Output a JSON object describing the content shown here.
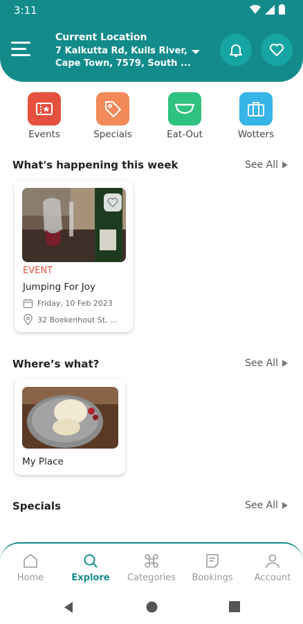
{
  "status": {
    "time": "3:11"
  },
  "header": {
    "location_title": "Current Location",
    "location_address": "7 Kalkutta Rd, Kuils River,\nCape Town, 7579, South ..."
  },
  "categories": [
    {
      "label": "Events",
      "icon": "ticket-icon",
      "color": "#e5513f"
    },
    {
      "label": "Specials",
      "icon": "tag-icon",
      "color": "#f28a5a"
    },
    {
      "label": "Eat-Out",
      "icon": "bowl-icon",
      "color": "#2ec27e"
    },
    {
      "label": "Wotters",
      "icon": "suitcase-icon",
      "color": "#37b4e8"
    }
  ],
  "sections": {
    "happening": {
      "title": "What's happening this week",
      "see_all": "See All"
    },
    "wheres_what": {
      "title": "Where’s what?",
      "see_all": "See All"
    },
    "specials": {
      "title": "Specials",
      "see_all": "See All"
    }
  },
  "event_card": {
    "type_label": "EVENT",
    "title": "Jumping For Joy",
    "date": "Friday, 10 Feb 2023",
    "address": "32 Boekenhout St, ..."
  },
  "place_card": {
    "title": "My Place"
  },
  "bottom_nav": [
    {
      "label": "Home",
      "icon": "home-icon",
      "active": false
    },
    {
      "label": "Explore",
      "icon": "search-icon",
      "active": true
    },
    {
      "label": "Categories",
      "icon": "command-icon",
      "active": false
    },
    {
      "label": "Bookings",
      "icon": "bookings-icon",
      "active": false
    },
    {
      "label": "Account",
      "icon": "account-icon",
      "active": false
    }
  ],
  "colors": {
    "primary": "#138b8b",
    "accent_event": "#e5513f"
  }
}
